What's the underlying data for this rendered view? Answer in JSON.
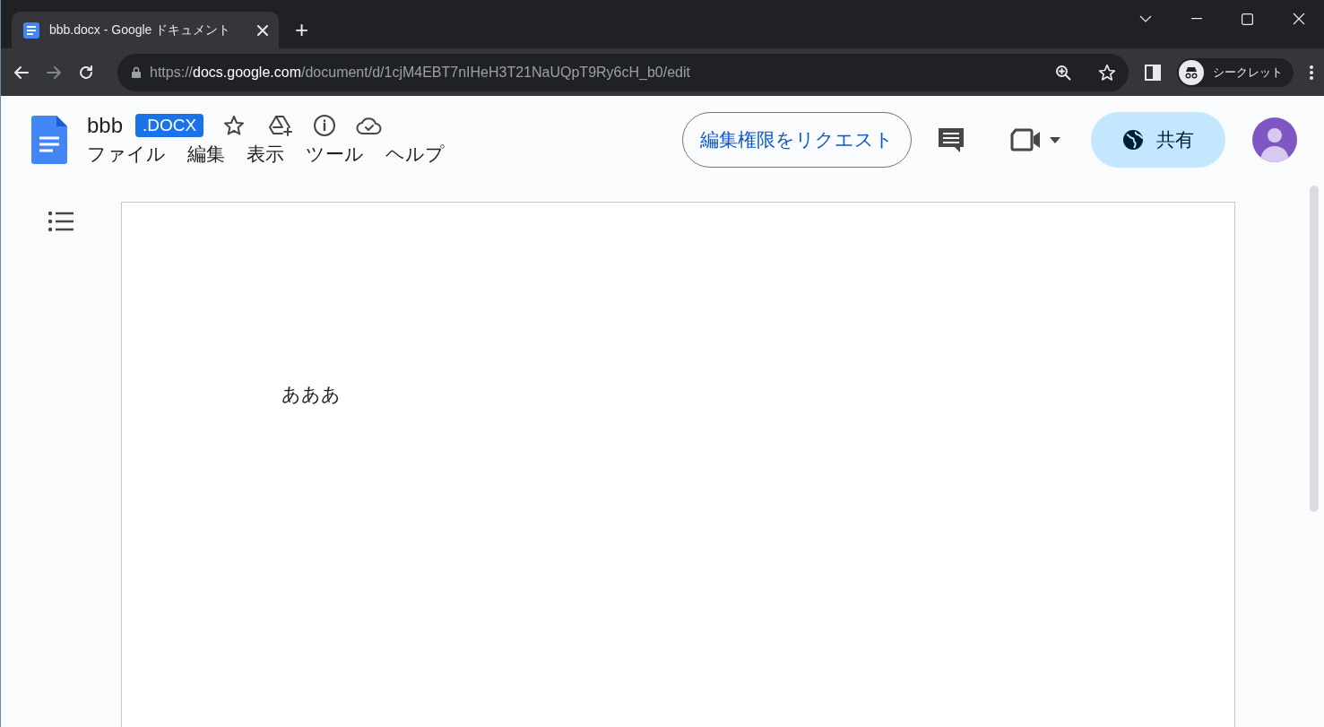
{
  "browser": {
    "tabs": [
      {
        "title": "bbb.docx - Google ドキュメント",
        "selected": true
      }
    ],
    "new_tab": "+",
    "address": {
      "scheme": "https://",
      "host": "docs.google.com",
      "path": "/document/d/1cjM4EBT7nIHeH3T21NaUQpT9Ry6cH_b0/edit"
    },
    "profile": "シークレット"
  },
  "doc": {
    "title": "bbb",
    "badge": ".DOCX",
    "menu": [
      {
        "label": "ファイル"
      },
      {
        "label": "編集"
      },
      {
        "label": "表示"
      },
      {
        "label": "ツール"
      },
      {
        "label": "ヘルプ"
      }
    ],
    "request_button": "編集権限をリクエスト",
    "share_button": "共有",
    "body": "あああ"
  }
}
